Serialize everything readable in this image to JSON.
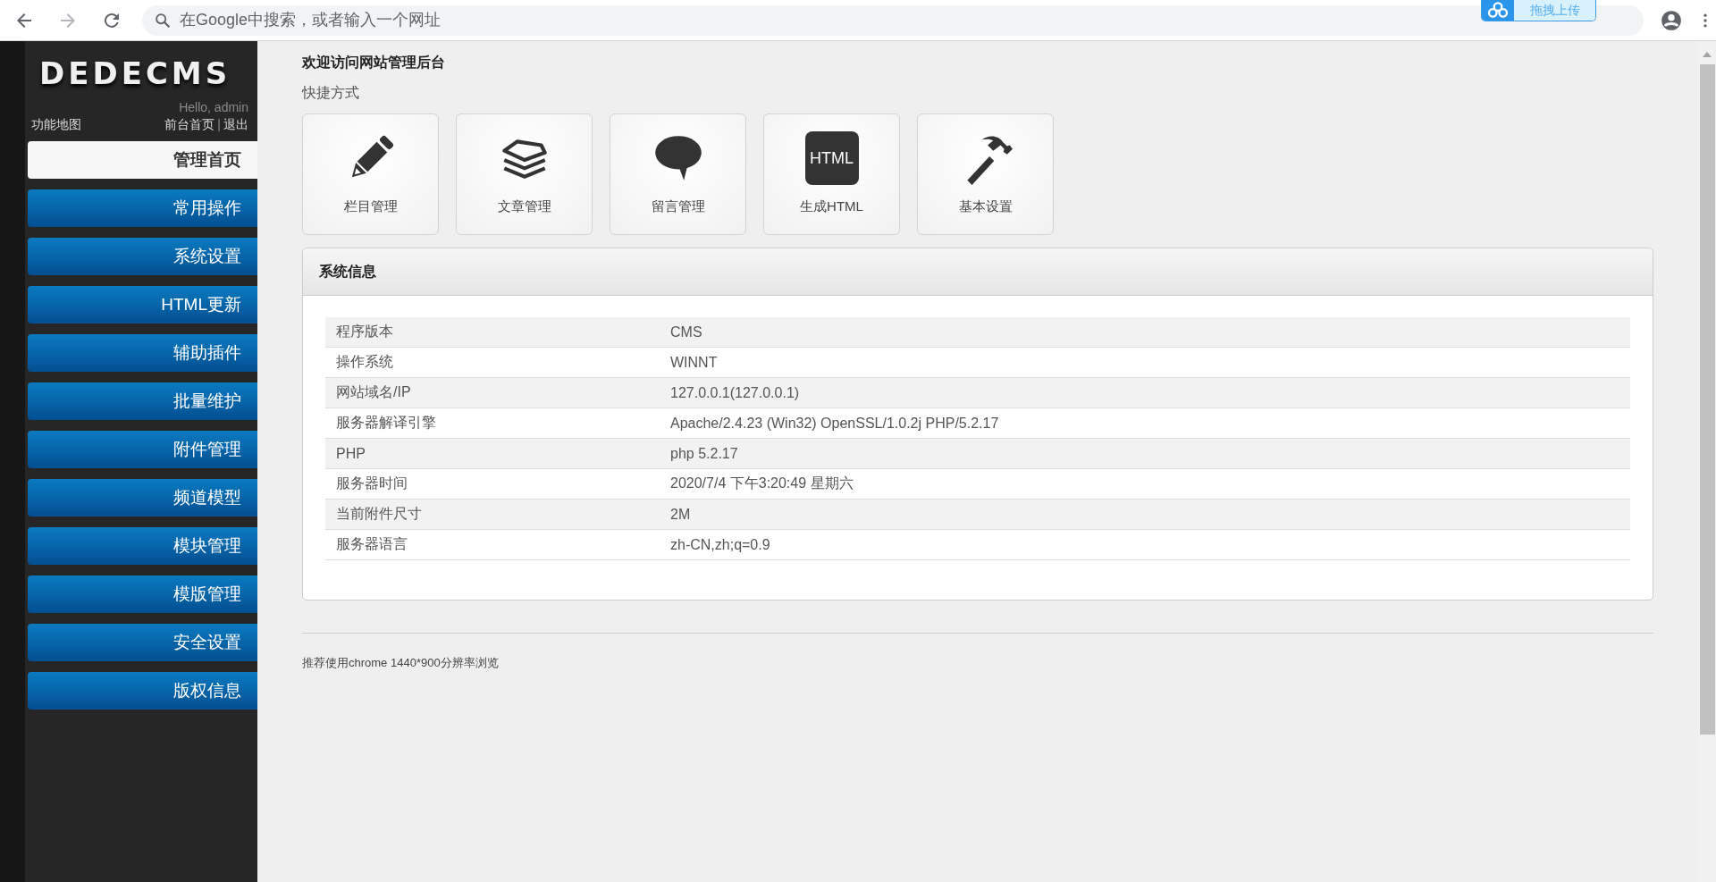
{
  "browser": {
    "address_placeholder": "在Google中搜索，或者输入一个网址",
    "upload_widget": "拖拽上传"
  },
  "sidebar": {
    "logo": "DEDECMS",
    "greeting": "Hello, admin",
    "map_link": "功能地图",
    "front_link": "前台首页",
    "separator": "|",
    "logout_link": "退出",
    "items": [
      {
        "label": "管理首页",
        "selected": true
      },
      {
        "label": "常用操作",
        "selected": false
      },
      {
        "label": "系统设置",
        "selected": false
      },
      {
        "label": "HTML更新",
        "selected": false
      },
      {
        "label": "辅助插件",
        "selected": false
      },
      {
        "label": "批量维护",
        "selected": false
      },
      {
        "label": "附件管理",
        "selected": false
      },
      {
        "label": "频道模型",
        "selected": false
      },
      {
        "label": "模块管理",
        "selected": false
      },
      {
        "label": "模版管理",
        "selected": false
      },
      {
        "label": "安全设置",
        "selected": false
      },
      {
        "label": "版权信息",
        "selected": false
      }
    ]
  },
  "main": {
    "title": "欢迎访问网站管理后台",
    "shortcuts_heading": "快捷方式",
    "shortcuts": [
      {
        "kind": "pencil",
        "label": "栏目管理"
      },
      {
        "kind": "papers",
        "label": "文章管理"
      },
      {
        "kind": "speech",
        "label": "留言管理"
      },
      {
        "kind": "html",
        "label": "生成HTML",
        "icon_text": "HTML"
      },
      {
        "kind": "hammer",
        "label": "基本设置"
      }
    ],
    "system_info": {
      "title": "系统信息",
      "rows": [
        {
          "name": "程序版本",
          "value": "CMS"
        },
        {
          "name": "操作系统",
          "value": "WINNT"
        },
        {
          "name": "网站域名/IP",
          "value": "127.0.0.1(127.0.0.1)"
        },
        {
          "name": "服务器解译引擎",
          "value": "Apache/2.4.23 (Win32) OpenSSL/1.0.2j PHP/5.2.17"
        },
        {
          "name": "PHP",
          "value": "php 5.2.17"
        },
        {
          "name": "服务器时间",
          "value": "2020/7/4 下午3:20:49 星期六"
        },
        {
          "name": "当前附件尺寸",
          "value": "2M"
        },
        {
          "name": "服务器语言",
          "value": "zh-CN,zh;q=0.9"
        }
      ]
    },
    "footer": "推荐使用chrome 1440*900分辨率浏览"
  }
}
